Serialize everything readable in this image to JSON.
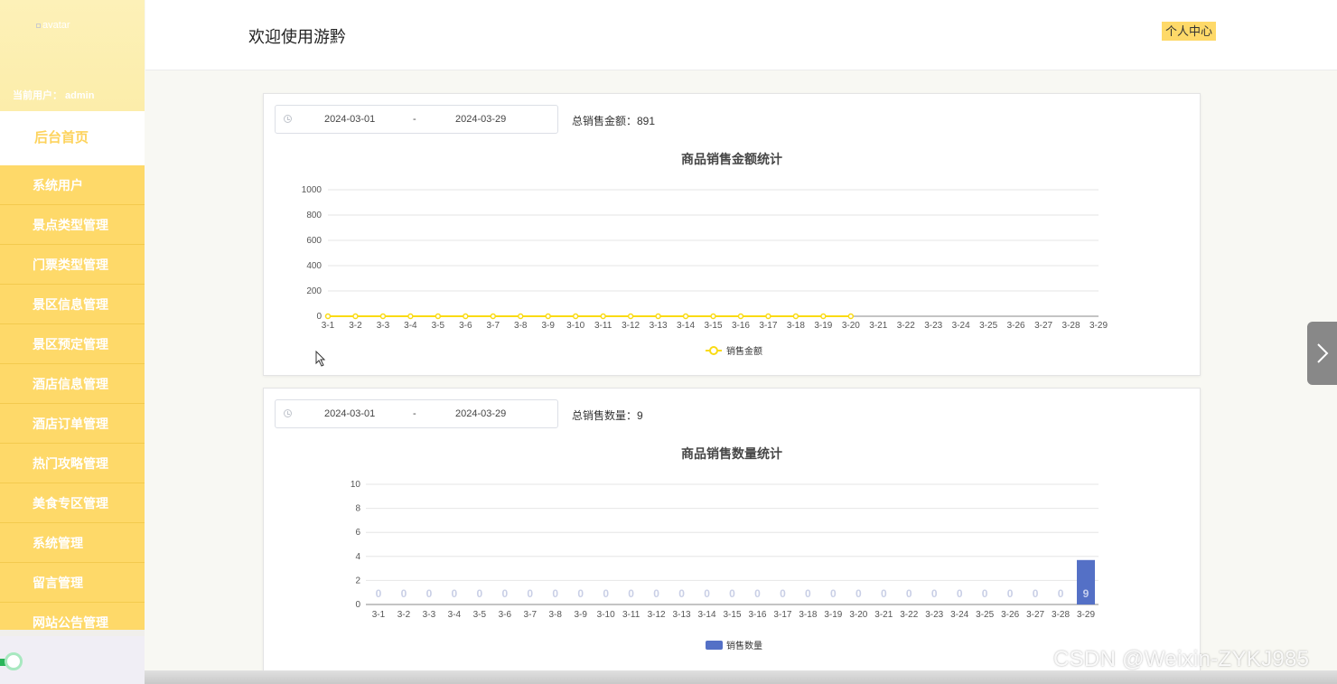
{
  "sidebar": {
    "avatar_alt": "avatar",
    "current_user": "当前用户： admin",
    "items": [
      {
        "label": "后台首页",
        "active": true
      },
      {
        "label": "系统用户"
      },
      {
        "label": "景点类型管理"
      },
      {
        "label": "门票类型管理"
      },
      {
        "label": "景区信息管理"
      },
      {
        "label": "景区预定管理"
      },
      {
        "label": "酒店信息管理"
      },
      {
        "label": "酒店订单管理"
      },
      {
        "label": "热门攻略管理"
      },
      {
        "label": "美食专区管理"
      },
      {
        "label": "系统管理"
      },
      {
        "label": "留言管理"
      },
      {
        "label": "网站公告管理"
      }
    ]
  },
  "header": {
    "title": "欢迎使用游黔",
    "personal_center": "个人中心"
  },
  "sales_amount": {
    "date_start": "2024-03-01",
    "date_sep": "-",
    "date_end": "2024-03-29",
    "total_label": "总销售金额：891",
    "chart_title": "商品销售金额统计"
  },
  "sales_count": {
    "date_start": "2024-03-01",
    "date_sep": "-",
    "date_end": "2024-03-29",
    "total_label": "总销售数量：9",
    "chart_title": "商品销售数量统计"
  },
  "watermark": "CSDN @Weixin-ZYKJ985",
  "colors": {
    "sidebar_menu": "#fed969",
    "line_series": "#fadb14",
    "bar_series": "#5470c6"
  },
  "chart_data": [
    {
      "type": "line",
      "title": "商品销售金额统计",
      "categories": [
        "3-1",
        "3-2",
        "3-3",
        "3-4",
        "3-5",
        "3-6",
        "3-7",
        "3-8",
        "3-9",
        "3-10",
        "3-11",
        "3-12",
        "3-13",
        "3-14",
        "3-15",
        "3-16",
        "3-17",
        "3-18",
        "3-19",
        "3-20",
        "3-21",
        "3-22",
        "3-23",
        "3-24",
        "3-25",
        "3-26",
        "3-27",
        "3-28",
        "3-29"
      ],
      "series": [
        {
          "name": "销售金额",
          "values": [
            0,
            0,
            0,
            0,
            0,
            0,
            0,
            0,
            0,
            0,
            0,
            0,
            0,
            0,
            0,
            0,
            0,
            0,
            0,
            0
          ]
        }
      ],
      "yticks": [
        0,
        200,
        400,
        600,
        800,
        1000
      ],
      "ylim": [
        0,
        1000
      ],
      "legend": "bottom-center",
      "grid": true
    },
    {
      "type": "bar",
      "title": "商品销售数量统计",
      "categories": [
        "3-1",
        "3-2",
        "3-3",
        "3-4",
        "3-5",
        "3-6",
        "3-7",
        "3-8",
        "3-9",
        "3-10",
        "3-11",
        "3-12",
        "3-13",
        "3-14",
        "3-15",
        "3-16",
        "3-17",
        "3-18",
        "3-19",
        "3-20",
        "3-21",
        "3-22",
        "3-23",
        "3-24",
        "3-25",
        "3-26",
        "3-27",
        "3-28",
        "3-29"
      ],
      "series": [
        {
          "name": "销售数量",
          "values": [
            0,
            0,
            0,
            0,
            0,
            0,
            0,
            0,
            0,
            0,
            0,
            0,
            0,
            0,
            0,
            0,
            0,
            0,
            0,
            0,
            0,
            0,
            0,
            0,
            0,
            0,
            0,
            0,
            3.7
          ]
        }
      ],
      "data_labels": [
        "0",
        "0",
        "0",
        "0",
        "0",
        "0",
        "0",
        "0",
        "0",
        "0",
        "0",
        "0",
        "0",
        "0",
        "0",
        "0",
        "0",
        "0",
        "0",
        "0",
        "0",
        "0",
        "0",
        "0",
        "0",
        "0",
        "0",
        "0",
        "9"
      ],
      "yticks": [
        0,
        2,
        4,
        6,
        8,
        10
      ],
      "ylim": [
        0,
        10
      ],
      "legend": "bottom-center",
      "grid": true
    }
  ]
}
